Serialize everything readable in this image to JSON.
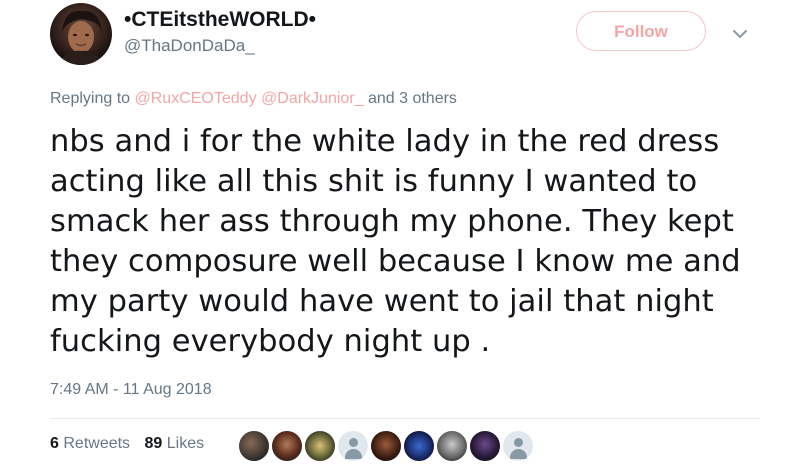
{
  "author": {
    "display_name": "•CTEitstheWORLD•",
    "handle": "@ThaDonDaDa_"
  },
  "follow_button": {
    "label": "Follow"
  },
  "reply": {
    "prefix": "Replying to",
    "mention_1": "@RuxCEOTeddy",
    "mention_2": "@DarkJunior_",
    "suffix": "and 3 others"
  },
  "tweet": {
    "text": "nbs and i for the white lady in the red dress acting like all this shit is funny I wanted to smack her ass through my phone. They kept they composure well because I know me and my party would have went to jail that night fucking everybody night up .",
    "timestamp": "7:49 AM - 11 Aug 2018"
  },
  "stats": {
    "retweets_count": "6",
    "retweets_label": "Retweets",
    "likes_count": "89",
    "likes_label": "Likes"
  },
  "colors": {
    "accent_faded": "#f4a6a6",
    "secondary_text": "#657786",
    "primary_text": "#14171a"
  },
  "icons": {
    "more": "chevron-down-icon",
    "default_avatar": "default-profile-icon"
  }
}
